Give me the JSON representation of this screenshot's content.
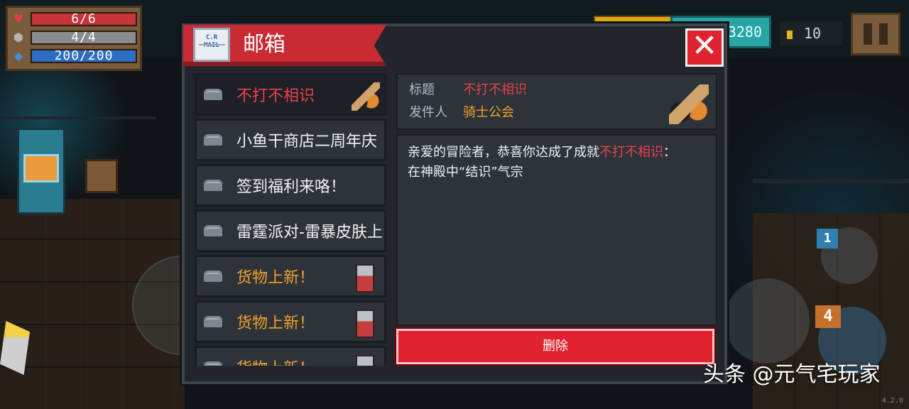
{
  "hud": {
    "hp": "6/6",
    "shield": "4/4",
    "mana": "200/200",
    "gems": "3280",
    "coins": "10",
    "hp_icon": "heart-icon",
    "shield_icon": "shield-icon",
    "mana_icon": "mana-crystal-icon"
  },
  "mailbox": {
    "title": "邮箱",
    "icon_text_line1": "C.R",
    "icon_text_line2": "MAIL",
    "close_symbol": "✕",
    "messages": [
      {
        "title": "不打不相识",
        "color": "red",
        "avatar": "knight-guild"
      },
      {
        "title": "小鱼干商店二周年庆",
        "color": "white",
        "avatar": ""
      },
      {
        "title": "签到福利来咯！",
        "color": "white",
        "avatar": ""
      },
      {
        "title": "雷霆派对-雷暴皮肤上",
        "color": "white",
        "avatar": ""
      },
      {
        "title": "货物上新！",
        "color": "orange",
        "avatar": "merchant"
      },
      {
        "title": "货物上新！",
        "color": "orange",
        "avatar": "merchant"
      },
      {
        "title": "货物上新！",
        "color": "orange",
        "avatar": "merchant"
      }
    ],
    "detail": {
      "subject_label": "标题",
      "subject_value": "不打不相识",
      "sender_label": "发件人",
      "sender_value": "骑士公会",
      "body_prefix": "亲爱的冒险者，恭喜你达成了成就",
      "body_highlight": "不打不相识",
      "body_suffix": "：",
      "body_line2": "在神殿中“结识”气宗"
    },
    "delete_label": "删除"
  },
  "overlay": {
    "watermark": "头条 @元气宅玩家",
    "version": "4.2.0"
  },
  "skills": {
    "slot_one": "1",
    "slot_four": "4"
  },
  "colors": {
    "accent_red": "#e0232f",
    "highlight_red": "#e8414a",
    "highlight_orange": "#f0a22c",
    "panel": "#22262c"
  }
}
